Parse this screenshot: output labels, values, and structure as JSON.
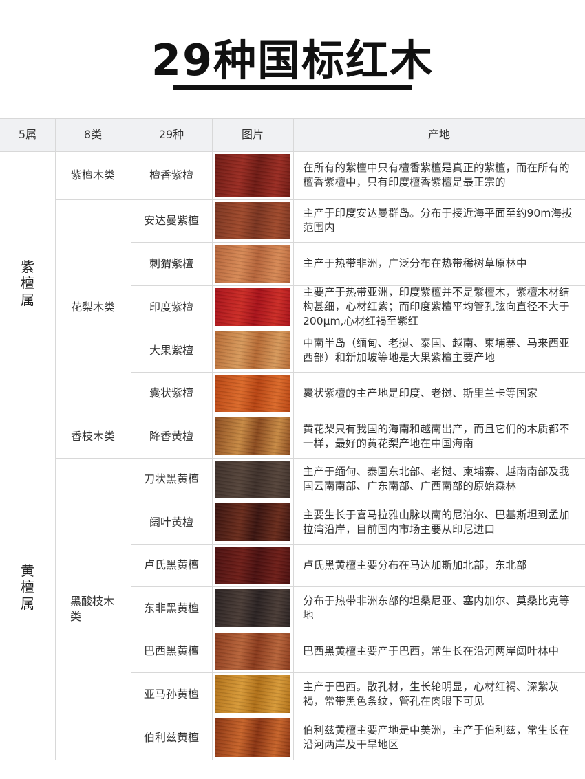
{
  "title": "29种国标红木",
  "headers": [
    "5属",
    "8类",
    "29种",
    "图片",
    "产地"
  ],
  "genera": [
    {
      "name_chars": [
        "紫",
        "檀",
        "属"
      ]
    },
    {
      "name_chars": [
        "黄",
        "檀",
        "属"
      ]
    }
  ],
  "categories": [
    {
      "label": "紫檀木类"
    },
    {
      "label": "花梨木类"
    },
    {
      "label": "香枝木类"
    },
    {
      "label": "黑酸枝木类"
    }
  ],
  "rows": [
    {
      "species": "檀香紫檀",
      "origin": "在所有的紫檀中只有檀香紫檀是真正的紫檀，而在所有的檀香紫檀中，只有印度檀香紫檀是最正宗的",
      "wood_color": "#6e1a14",
      "wood_color2": "#9a2c22"
    },
    {
      "species": "安达曼紫檀",
      "origin": "主产于印度安达曼群岛。分布于接近海平面至约90m海拔范围内",
      "wood_color": "#7a3420",
      "wood_color2": "#a04a2c"
    },
    {
      "species": "刺猬紫檀",
      "origin": "主产于热带非洲，广泛分布在热带稀树草原林中",
      "wood_color": "#b5643a",
      "wood_color2": "#d88a56"
    },
    {
      "species": "印度紫檀",
      "origin": "主要产于热带亚洲，印度紫檀并不是紫檀木，紫檀木材结构甚细，心材红紫；而印度紫檀平均管孔弦向直径不大于200μm,心材红褐至紫红",
      "wood_color": "#a8121a",
      "wood_color2": "#cc2c26"
    },
    {
      "species": "大果紫檀",
      "origin": "中南半岛（缅甸、老挝、泰国、越南、柬埔寨、马来西亚西部）和新加坡等地是大果紫檀主要产地",
      "wood_color": "#b66a34",
      "wood_color2": "#d89a5c"
    },
    {
      "species": "囊状紫檀",
      "origin": "囊状紫檀的主产地是印度、老挝、斯里兰卡等国家",
      "wood_color": "#b84412",
      "wood_color2": "#dc6a2a"
    },
    {
      "species": "降香黄檀",
      "origin": "黄花梨只有我国的海南和越南出产，而且它们的木质都不一样，最好的黄花梨产地在中国海南",
      "wood_color": "#8a4a1e",
      "wood_color2": "#c88a44"
    },
    {
      "species": "刀状黑黄檀",
      "origin": "主产于缅甸、泰国东北部、老挝、柬埔寨、越南南部及我国云南南部、广东南部、广西南部的原始森林",
      "wood_color": "#3e302a",
      "wood_color2": "#55443a"
    },
    {
      "species": "阔叶黄檀",
      "origin": "主要生长于喜马拉雅山脉以南的尼泊尔、巴基斯坦到孟加拉湾沿岸，目前国内市场主要从印尼进口",
      "wood_color": "#3a1410",
      "wood_color2": "#6a2c1c"
    },
    {
      "species": "卢氏黑黄檀",
      "origin": "卢氏黑黄檀主要分布在马达加斯加北部，东北部",
      "wood_color": "#4a1010",
      "wood_color2": "#6e1e18"
    },
    {
      "species": "东非黑黄檀",
      "origin": "分布于热带非洲东部的坦桑尼亚、塞内加尔、莫桑比克等地",
      "wood_color": "#2a2222",
      "wood_color2": "#4a3c36"
    },
    {
      "species": "巴西黑黄檀",
      "origin": "巴西黑黄檀主要产于巴西，常生长在沿河两岸阔叶林中",
      "wood_color": "#8a3a1c",
      "wood_color2": "#b8643a"
    },
    {
      "species": "亚马孙黄檀",
      "origin": "主产于巴西。散孔材，生长轮明显，心材红褐、深紫灰褐，常带黑色条纹，管孔在肉眼下可见",
      "wood_color": "#b07018",
      "wood_color2": "#d89a38"
    },
    {
      "species": "伯利兹黄檀",
      "origin": "伯利兹黄檀主要产地是中美洲，主产于伯利兹，常生长在沿河两岸及干旱地区",
      "wood_color": "#8a3412",
      "wood_color2": "#c8642a"
    }
  ]
}
